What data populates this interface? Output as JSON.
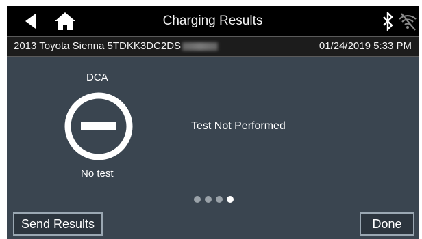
{
  "header": {
    "title": "Charging Results",
    "back_icon": "back-arrow-icon",
    "home_icon": "home-icon",
    "bluetooth_icon": "bluetooth-icon",
    "wifi_icon": "wifi-off-icon"
  },
  "info": {
    "vehicle": "2013 Toyota Sienna  5TDKK3DC2DS",
    "datetime": "01/24/2019 5:33 PM"
  },
  "result": {
    "label": "DCA",
    "icon": "no-test-icon",
    "caption": "No test",
    "status": "Test Not Performed"
  },
  "pager": {
    "page": 4,
    "total": 4
  },
  "buttons": {
    "send": "Send Results",
    "done": "Done"
  },
  "colors": {
    "background": "#3a4550",
    "topbar": "#000000",
    "infobar": "#1c1c1c",
    "button_border": "#9aa7b2"
  }
}
